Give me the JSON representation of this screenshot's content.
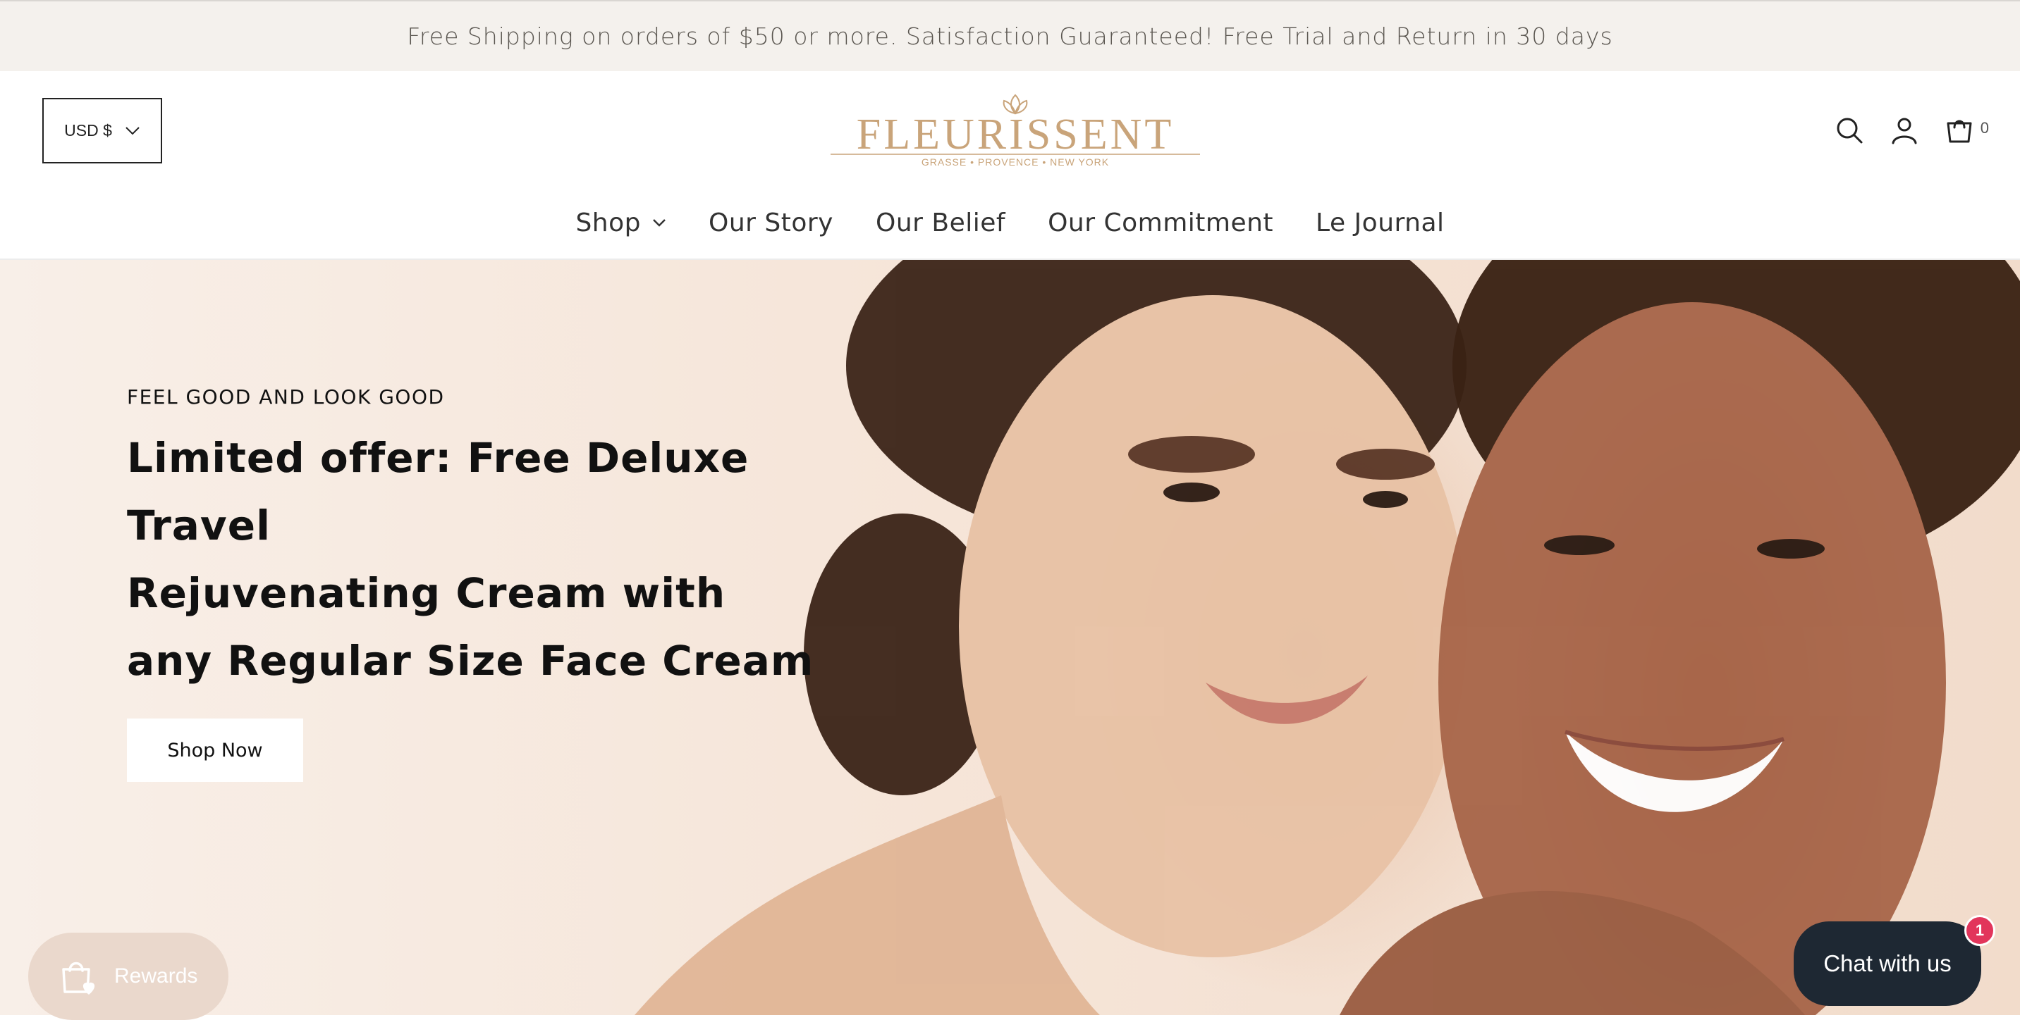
{
  "announcement": {
    "text": "Free Shipping on orders of $50 or more. Satisfaction Guaranteed! Free Trial and Return in 30 days"
  },
  "header": {
    "currency_label": "USD $",
    "logo": {
      "brand": "FLEURISSENT",
      "tagline": "GRASSE • PROVENCE • NEW YORK",
      "color": "#c9a47a"
    },
    "cart_count": "0"
  },
  "nav": {
    "items": [
      {
        "label": "Shop",
        "has_dropdown": true
      },
      {
        "label": "Our Story"
      },
      {
        "label": "Our Belief"
      },
      {
        "label": "Our Commitment"
      },
      {
        "label": "Le Journal"
      }
    ]
  },
  "hero": {
    "eyebrow": "FEEL GOOD AND LOOK GOOD",
    "headline_lines": [
      "Limited offer: Free Deluxe Travel",
      "Rejuvenating Cream with",
      "any Regular Size Face Cream"
    ],
    "cta_label": "Shop Now"
  },
  "rewards": {
    "label": "Rewards"
  },
  "chat": {
    "label": "Chat with us",
    "badge": "1"
  },
  "colors": {
    "announcement_bg": "#f4f1ed",
    "brand_gold": "#c9a47a",
    "chat_bg": "#1e2833",
    "chat_badge": "#e2355b",
    "rewards_bg": "#ead8cc"
  }
}
